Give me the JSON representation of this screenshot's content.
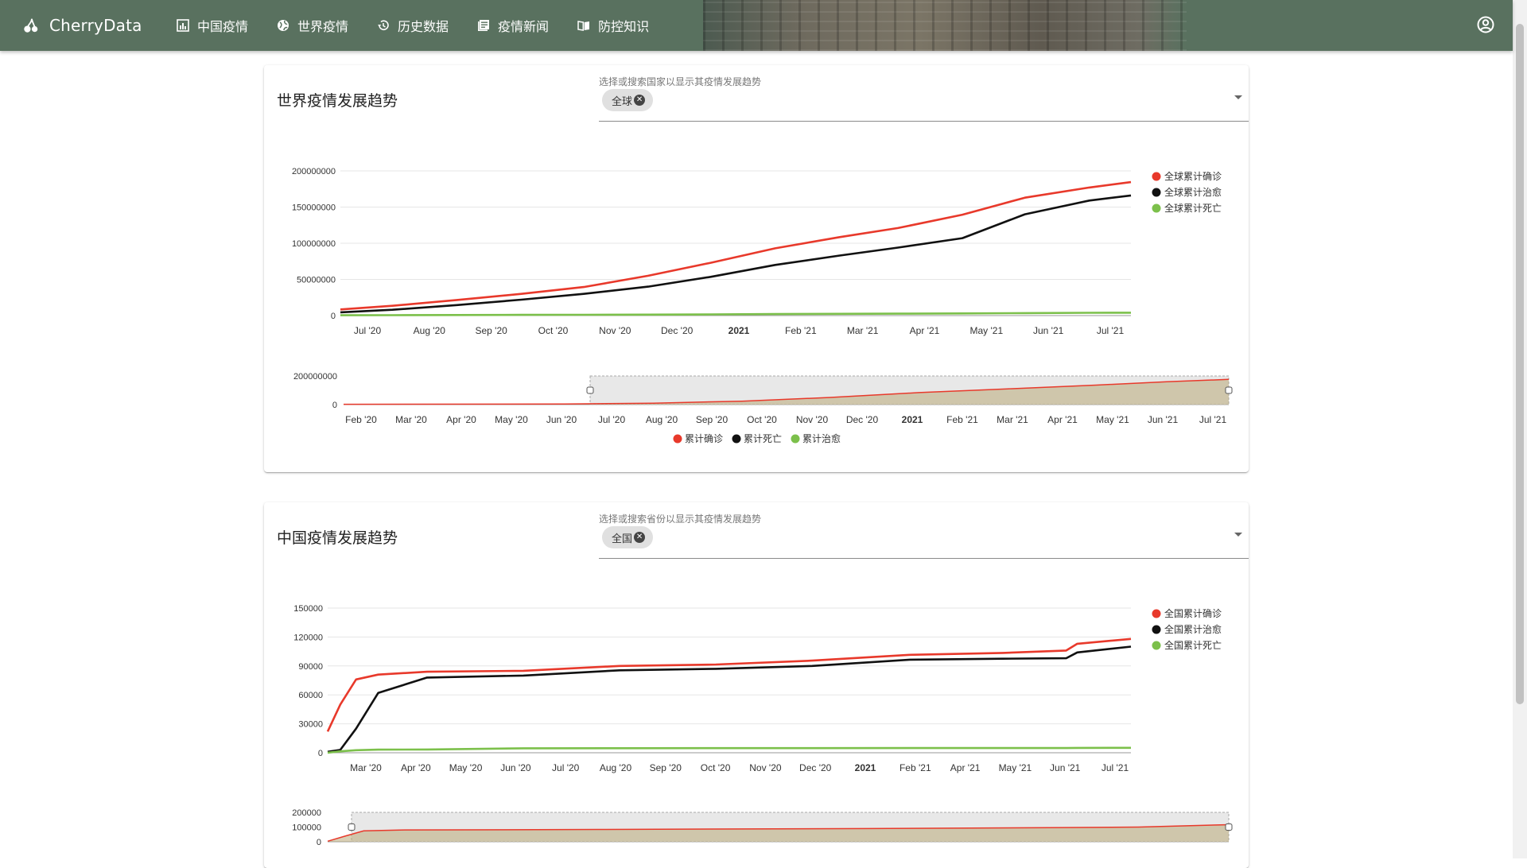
{
  "app": {
    "name": "CherryData",
    "nav": [
      {
        "label": "中国疫情",
        "icon": "chart-icon"
      },
      {
        "label": "世界疫情",
        "icon": "globe-icon"
      },
      {
        "label": "历史数据",
        "icon": "history-icon"
      },
      {
        "label": "疫情新闻",
        "icon": "news-icon"
      },
      {
        "label": "防控知识",
        "icon": "book-icon"
      }
    ],
    "account_icon": "account-circle-icon"
  },
  "world": {
    "title": "世界疫情发展趋势",
    "selector_label": "选择或搜索国家以显示其疫情发展趋势",
    "chip": "全球"
  },
  "china": {
    "title": "中国疫情发展趋势",
    "selector_label": "选择或搜索省份以显示其疫情发展趋势",
    "chip": "全国"
  },
  "chart_data": [
    {
      "type": "line",
      "id": "world-main",
      "x_ticks": [
        "Jul '20",
        "Aug '20",
        "Sep '20",
        "Oct '20",
        "Nov '20",
        "Dec '20",
        "2021",
        "Feb '21",
        "Mar '21",
        "Apr '21",
        "May '21",
        "Jun '21",
        "Jul '21"
      ],
      "y_ticks": [
        "0",
        "50000000",
        "100000000",
        "150000000",
        "200000000"
      ],
      "ylim": [
        0,
        200000000
      ],
      "legend": [
        "全球累计确诊",
        "全球累计治愈",
        "全球累计死亡"
      ],
      "x": [
        "2020-06-20",
        "2020-07-15",
        "2020-08-15",
        "2020-09-15",
        "2020-10-15",
        "2020-11-15",
        "2020-12-15",
        "2021-01-15",
        "2021-02-15",
        "2021-03-15",
        "2021-04-15",
        "2021-05-15",
        "2021-06-15",
        "2021-07-05"
      ],
      "series": [
        {
          "name": "全球累计确诊",
          "color": "#e8392b",
          "values": [
            8500000,
            13500000,
            21500000,
            30000000,
            39500000,
            55000000,
            73000000,
            93000000,
            108500000,
            121000000,
            139500000,
            163000000,
            177000000,
            184500000
          ]
        },
        {
          "name": "全球累计治愈",
          "color": "#111111",
          "values": [
            4500000,
            8000000,
            14500000,
            22000000,
            30000000,
            40000000,
            53500000,
            70000000,
            83000000,
            94000000,
            107000000,
            140000000,
            159000000,
            166000000
          ]
        },
        {
          "name": "全球累计死亡",
          "color": "#7cc04b",
          "values": [
            460000,
            580000,
            760000,
            940000,
            1100000,
            1350000,
            1650000,
            2050000,
            2400000,
            2680000,
            2980000,
            3400000,
            3850000,
            4000000
          ]
        }
      ]
    },
    {
      "type": "area",
      "id": "world-navigator",
      "x_ticks": [
        "Feb '20",
        "Mar '20",
        "Apr '20",
        "May '20",
        "Jun '20",
        "Jul '20",
        "Aug '20",
        "Sep '20",
        "Oct '20",
        "Nov '20",
        "Dec '20",
        "2021",
        "Feb '21",
        "Mar '21",
        "Apr '21",
        "May '21",
        "Jun '21",
        "Jul '21"
      ],
      "y_ticks": [
        "0",
        "200000000"
      ],
      "legend": [
        "累计确诊",
        "累计死亡",
        "累计治愈"
      ],
      "legend_colors": [
        "#e8392b",
        "#111111",
        "#7cc04b"
      ]
    },
    {
      "type": "line",
      "id": "china-main",
      "x_ticks": [
        "Mar '20",
        "Apr '20",
        "May '20",
        "Jun '20",
        "Jul '20",
        "Aug '20",
        "Sep '20",
        "Oct '20",
        "Nov '20",
        "Dec '20",
        "2021",
        "Feb '21",
        "Apr '21",
        "May '21",
        "Jun '21",
        "Jul '21"
      ],
      "y_ticks": [
        "0",
        "30000",
        "60000",
        "90000",
        "120000",
        "150000"
      ],
      "ylim": [
        0,
        150000
      ],
      "legend": [
        "全国累计确诊",
        "全国累计治愈",
        "全国累计死亡"
      ],
      "x": [
        "2020-02-12",
        "2020-02-20",
        "2020-03-01",
        "2020-03-15",
        "2020-04-15",
        "2020-06-15",
        "2020-08-15",
        "2020-10-15",
        "2020-12-15",
        "2021-02-15",
        "2021-04-15",
        "2021-05-25",
        "2021-06-01",
        "2021-07-05"
      ],
      "series": [
        {
          "name": "全国累计确诊",
          "color": "#e8392b",
          "values": [
            22000,
            50000,
            76000,
            81000,
            84000,
            85000,
            90000,
            91500,
            95500,
            101500,
            103500,
            106000,
            113000,
            118000
          ]
        },
        {
          "name": "全国累计治愈",
          "color": "#111111",
          "values": [
            1000,
            3000,
            25000,
            62000,
            78000,
            80000,
            85500,
            87000,
            90000,
            96500,
            97500,
            98000,
            104000,
            110000
          ]
        },
        {
          "name": "全国累计死亡",
          "color": "#7cc04b",
          "values": [
            100,
            1500,
            2600,
            3200,
            3400,
            4650,
            4700,
            4750,
            4800,
            4850,
            4850,
            4900,
            5000,
            5100
          ]
        }
      ]
    },
    {
      "type": "area",
      "id": "china-navigator",
      "y_ticks": [
        "0",
        "100000",
        "200000"
      ]
    }
  ]
}
